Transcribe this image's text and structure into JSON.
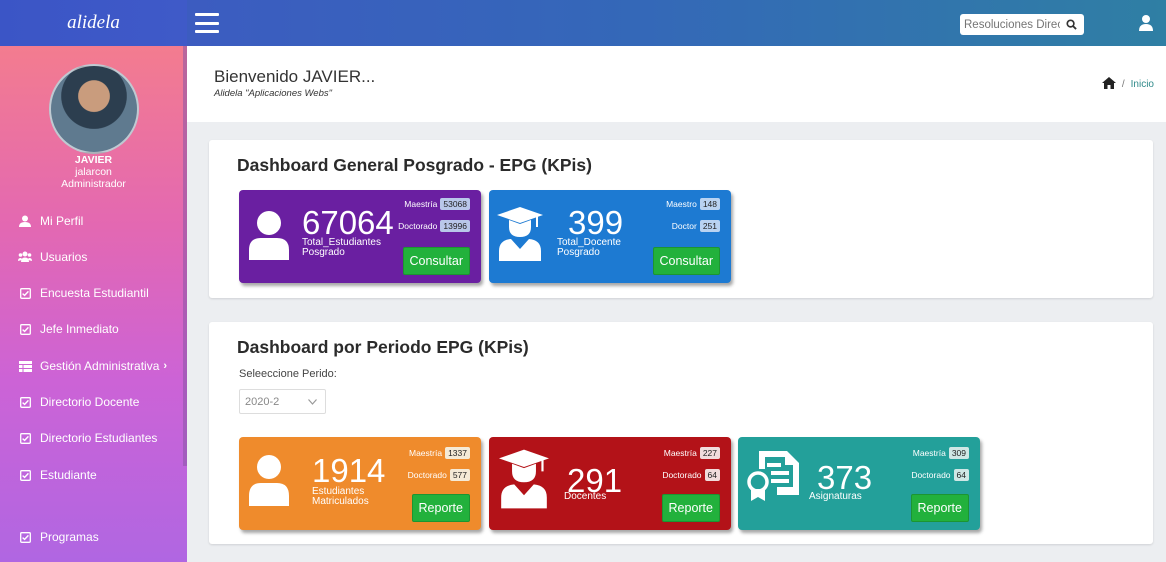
{
  "brand": "alidela",
  "search": {
    "placeholder": "Resoluciones Directo"
  },
  "user": {
    "name": "JAVIER",
    "username": "jalarcon",
    "role": "Administrador"
  },
  "menu": [
    {
      "label": "Mi Perfil",
      "icon": "user-icon"
    },
    {
      "label": "Usuarios",
      "icon": "users-icon"
    },
    {
      "label": "Encuesta Estudiantil",
      "icon": "checkbox-icon"
    },
    {
      "label": "Jefe Inmediato",
      "icon": "checkbox-icon"
    },
    {
      "label": "Gestión Administrativa",
      "icon": "table-icon",
      "arrow": "›"
    },
    {
      "label": "Directorio Docente",
      "icon": "checkbox-icon"
    },
    {
      "label": "Directorio Estudiantes",
      "icon": "checkbox-icon"
    },
    {
      "label": "Estudiante",
      "icon": "checkbox-icon"
    },
    {
      "label": "Programas",
      "icon": "checkbox-icon"
    }
  ],
  "header": {
    "title": "Bienvenido JAVIER...",
    "subtitle": "Alidela \"Aplicaciones Webs\"",
    "breadcrumb_sep": "/",
    "breadcrumb": "Inicio"
  },
  "general": {
    "title": "Dashboard General Posgrado - EPG (KPis)",
    "students": {
      "value": "67064",
      "label1": "Total_Estudiantes",
      "label2": "Posgrado",
      "b1_label": "Maestría",
      "b1": "53068",
      "b2_label": "Doctorado",
      "b2": "13996",
      "button": "Consultar",
      "color": "#6a1fa1"
    },
    "teachers": {
      "value": "399",
      "label1": "Total_Docente",
      "label2": "Posgrado",
      "b1_label": "Maestro",
      "b1": "148",
      "b2_label": "Doctor",
      "b2": "251",
      "button": "Consultar",
      "color": "#1d7ad2"
    }
  },
  "periodo": {
    "title": "Dashboard por Periodo EPG (KPis)",
    "select_label": "Seleeccione Perido:",
    "selected": "2020-2",
    "enrolled": {
      "value": "1914",
      "label1": "Estudiantes",
      "label2": "Matriculados",
      "b1_label": "Maestría",
      "b1": "1337",
      "b2_label": "Doctorado",
      "b2": "577",
      "button": "Reporte",
      "color": "#ef8b2c"
    },
    "teachers": {
      "value": "291",
      "label1": "Docentes",
      "b1_label": "Maestría",
      "b1": "227",
      "b2_label": "Doctorado",
      "b2": "64",
      "button": "Reporte",
      "color": "#b31218"
    },
    "subjects": {
      "value": "373",
      "label1": "Asignaturas",
      "b1_label": "Maestría",
      "b1": "309",
      "b2_label": "Doctorado",
      "b2": "64",
      "button": "Reporte",
      "color": "#23a09a"
    }
  }
}
